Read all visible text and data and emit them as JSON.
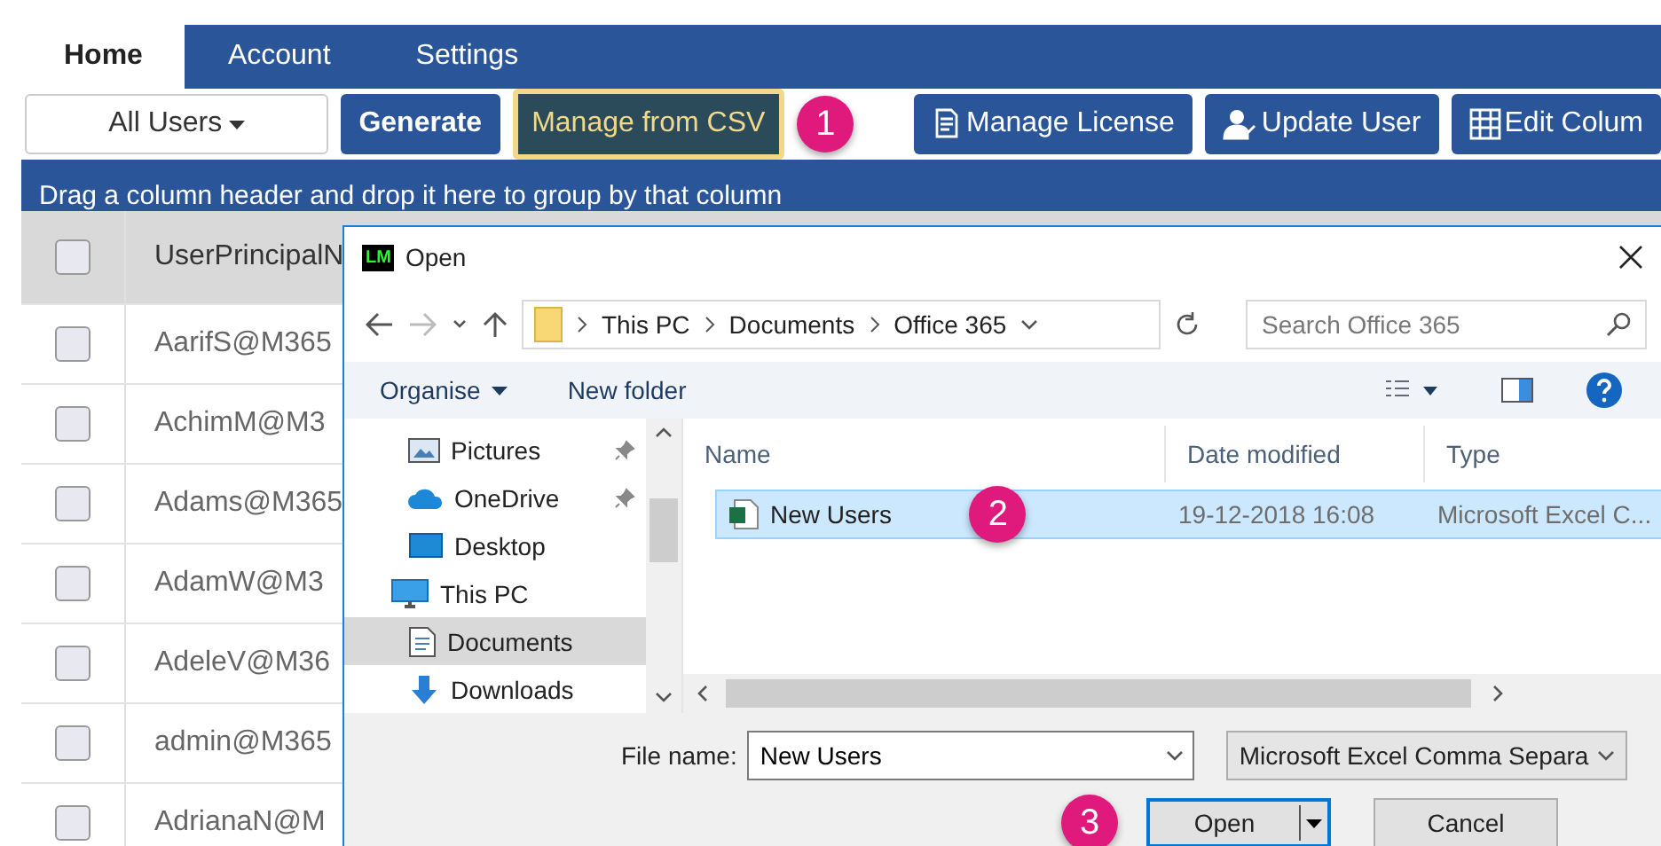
{
  "tabs": [
    {
      "label": "Home",
      "selected": true
    },
    {
      "label": "Account",
      "selected": false
    },
    {
      "label": "Settings",
      "selected": false
    }
  ],
  "toolbar": {
    "filter": "All Users",
    "buttons": [
      {
        "label": "Generate",
        "kind": "primary"
      },
      {
        "label": "Manage from CSV",
        "kind": "highlight",
        "step": "1"
      },
      {
        "label": "Manage License",
        "kind": "license"
      },
      {
        "label": "Update User",
        "kind": "user"
      },
      {
        "label": "Edit Colum",
        "kind": "columns"
      }
    ]
  },
  "group_bar": "Drag a column header and drop it here to group by that column",
  "table": {
    "header_checked": false,
    "columns": [
      "UserPrincipalN"
    ],
    "rows": [
      {
        "checked": false,
        "cells": [
          "AarifS@M365"
        ]
      },
      {
        "checked": false,
        "cells": [
          "AchimM@M3"
        ]
      },
      {
        "checked": false,
        "cells": [
          "Adams@M365"
        ]
      },
      {
        "checked": false,
        "cells": [
          "AdamW@M3"
        ]
      },
      {
        "checked": false,
        "cells": [
          "AdeleV@M36"
        ]
      },
      {
        "checked": false,
        "cells": [
          "admin@M365"
        ]
      },
      {
        "checked": false,
        "cells": [
          "AdrianaN@M"
        ]
      }
    ]
  },
  "dialog": {
    "app_badge": "LM",
    "title": "Open",
    "breadcrumb": [
      "This PC",
      "Documents",
      "Office 365"
    ],
    "search": {
      "placeholder": "Search Office 365"
    },
    "commands": [
      "Organise",
      "New folder"
    ],
    "nav": [
      {
        "label": "Pictures",
        "kind": "pictures",
        "pinned": true,
        "selected": false
      },
      {
        "label": "OneDrive",
        "kind": "cloud",
        "pinned": true,
        "selected": false
      },
      {
        "label": "Desktop",
        "kind": "desktop",
        "pinned": false,
        "selected": false
      },
      {
        "label": "This PC",
        "kind": "pc",
        "pinned": false,
        "selected": false,
        "children": [
          {
            "label": "Documents",
            "kind": "documents",
            "pinned": false,
            "selected": true
          },
          {
            "label": "Downloads",
            "kind": "downloads",
            "pinned": false,
            "selected": false
          }
        ]
      }
    ],
    "columns": [
      "Name",
      "Date modified",
      "Type"
    ],
    "files": [
      {
        "name": "New Users",
        "date": "19-12-2018 16:08",
        "type": "Microsoft Excel C...",
        "selected": true,
        "step": "2"
      }
    ],
    "file_name_label": "File name:",
    "file_name": "New Users",
    "file_type": "Microsoft Excel Comma Separa",
    "open": {
      "label": "Open",
      "step": "3"
    },
    "cancel": "Cancel"
  }
}
